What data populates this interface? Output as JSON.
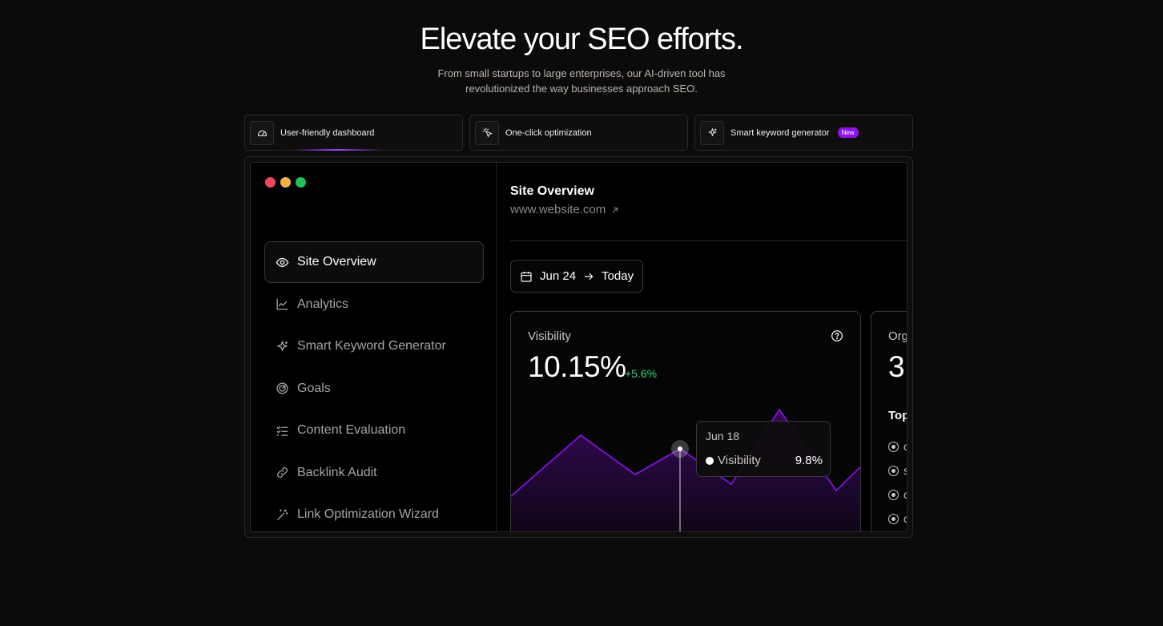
{
  "hero": {
    "title": "Elevate your SEO efforts.",
    "subtitle": "From small startups to large enterprises, our AI-driven tool has revolutionized the way businesses approach SEO."
  },
  "features": [
    {
      "label": "User-friendly dashboard",
      "icon": "dashboard-icon"
    },
    {
      "label": "One-click optimization",
      "icon": "click-icon"
    },
    {
      "label": "Smart keyword generator",
      "icon": "sparkle-icon",
      "badge": "New"
    }
  ],
  "colors": {
    "accent": "#8e11ef",
    "positive": "#2ed47a",
    "traffic_red": "#ef4858",
    "traffic_yellow": "#f2b544",
    "traffic_green": "#1ec15a"
  },
  "sidebar": {
    "items": [
      {
        "label": "Site Overview",
        "icon": "eye-icon",
        "active": true
      },
      {
        "label": "Analytics",
        "icon": "line-chart-icon"
      },
      {
        "label": "Smart Keyword Generator",
        "icon": "sparkle-icon"
      },
      {
        "label": "Goals",
        "icon": "target-icon"
      },
      {
        "label": "Content Evaluation",
        "icon": "checklist-icon"
      },
      {
        "label": "Backlink Audit",
        "icon": "link-icon"
      },
      {
        "label": "Link Optimization Wizard",
        "icon": "magic-wand-icon"
      }
    ]
  },
  "main": {
    "title": "Site Overview",
    "url": "www.website.com",
    "date_range": {
      "from": "Jun 24",
      "to": "Today"
    }
  },
  "visibility_card": {
    "label": "Visibility",
    "value": "10.15%",
    "delta": "+5.6%",
    "tooltip": {
      "date": "Jun 18",
      "series": "Visibility",
      "value": "9.8%"
    }
  },
  "organic_card": {
    "label": "Org",
    "value": "3",
    "section_title": "Top",
    "items": [
      "c",
      "s",
      "c",
      "c"
    ]
  }
}
